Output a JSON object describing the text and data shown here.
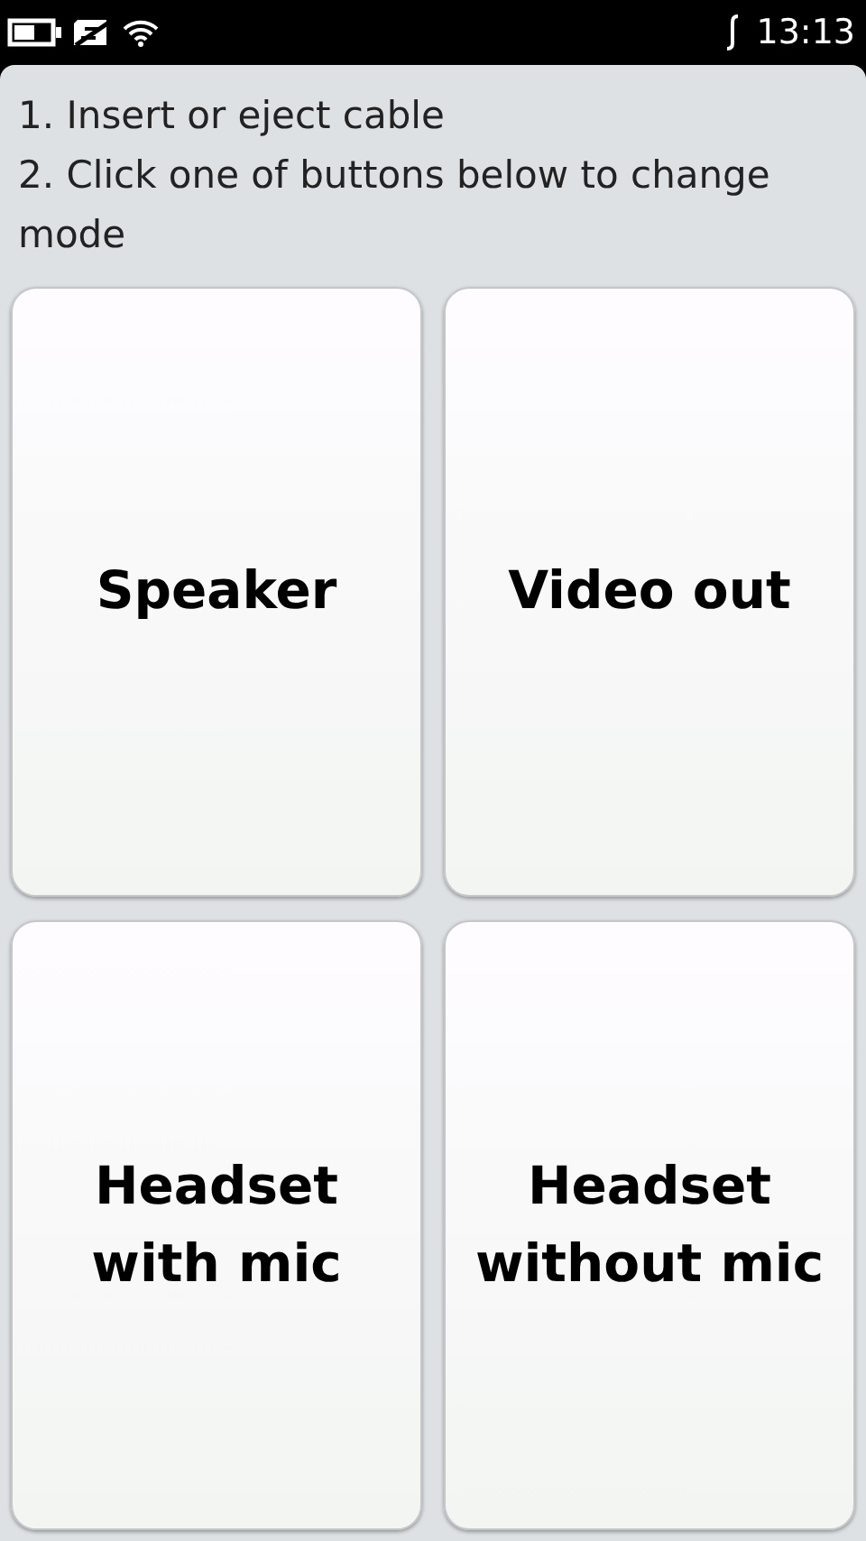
{
  "status_bar": {
    "time": "13:13"
  },
  "instructions": [
    "1. Insert or eject cable",
    "2. Click one of buttons below to change mode"
  ],
  "buttons": [
    {
      "label": "Speaker"
    },
    {
      "label": "Video out"
    },
    {
      "label": "Headset\nwith mic"
    },
    {
      "label": "Headset\nwithout mic"
    }
  ]
}
